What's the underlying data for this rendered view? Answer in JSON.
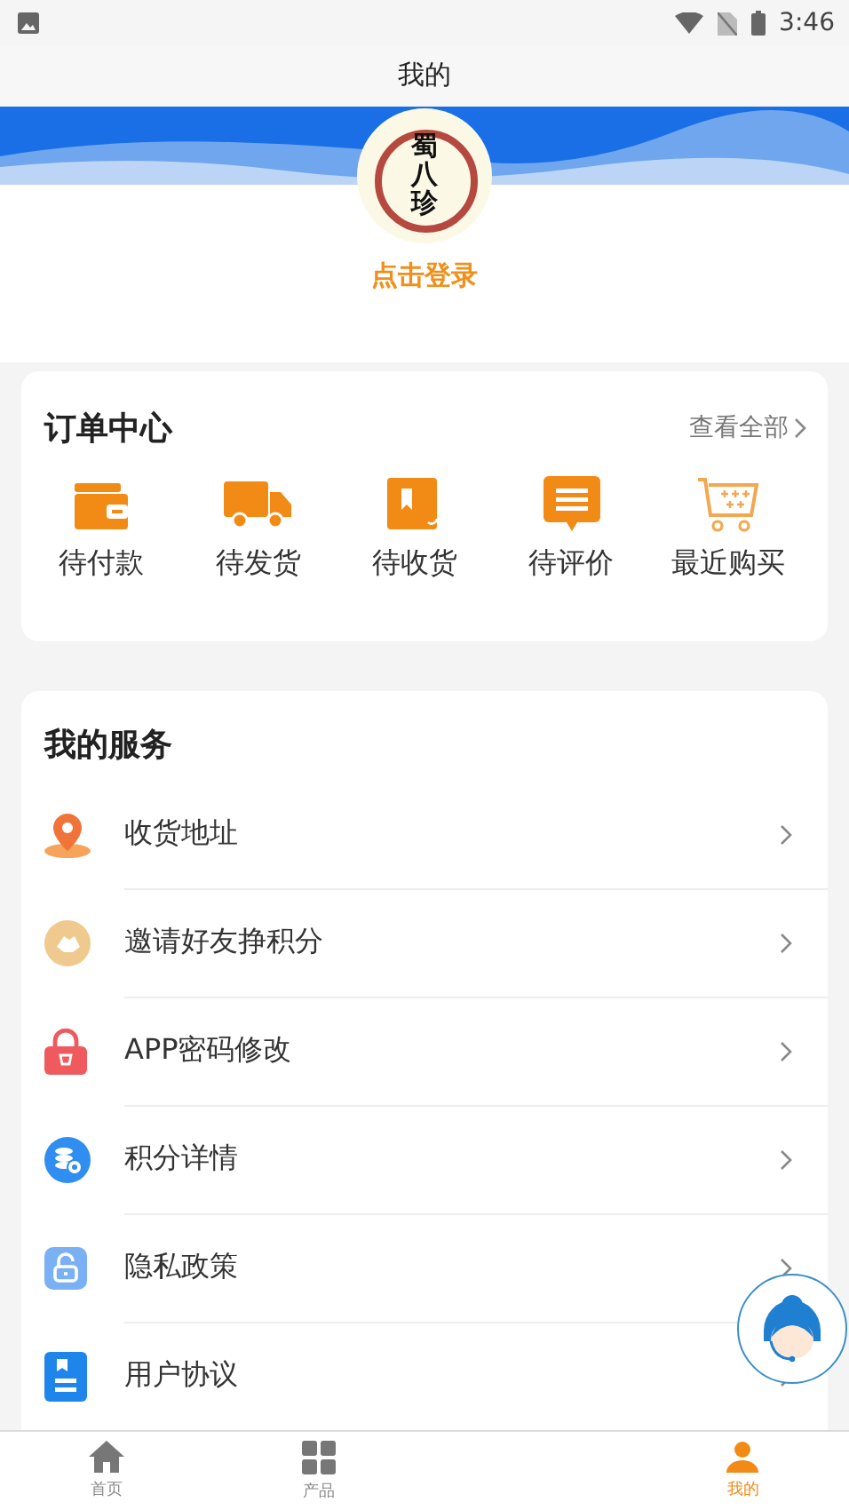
{
  "status_bar": {
    "time": "3:46"
  },
  "title": "我的",
  "profile": {
    "logo_text": "蜀八珍",
    "login": "点击登录"
  },
  "orders": {
    "title": "订单中心",
    "view_all": "查看全部",
    "items": [
      {
        "label": "待付款"
      },
      {
        "label": "待发货"
      },
      {
        "label": "待收货"
      },
      {
        "label": "待评价"
      },
      {
        "label": "最近购买"
      }
    ]
  },
  "services": {
    "title": "我的服务",
    "items": [
      {
        "label": "收货地址"
      },
      {
        "label": "邀请好友挣积分"
      },
      {
        "label": "APP密码修改"
      },
      {
        "label": "积分详情"
      },
      {
        "label": "隐私政策"
      },
      {
        "label": "用户协议"
      }
    ]
  },
  "bottom_nav": [
    {
      "label": "首页",
      "selected": false
    },
    {
      "label": "产品",
      "selected": false
    },
    {
      "label": "我的",
      "selected": true
    }
  ]
}
